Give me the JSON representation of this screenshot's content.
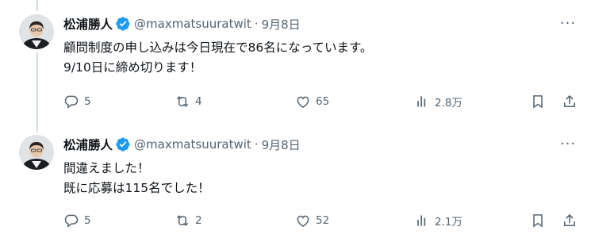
{
  "tweets": [
    {
      "author": {
        "name": "松浦勝人",
        "handle": "@maxmatsuuratwit",
        "separator": "·",
        "date": "9月8日"
      },
      "body_lines": [
        "顧問制度の申し込みは今日現在で86名になっています。",
        "9/10日に締め切ります！"
      ],
      "stats": {
        "replies": "5",
        "retweets": "4",
        "likes": "65",
        "views": "2.8万"
      }
    },
    {
      "author": {
        "name": "松浦勝人",
        "handle": "@maxmatsuuratwit",
        "separator": "·",
        "date": "9月8日"
      },
      "body_lines": [
        "間違えました！",
        "既に応募は115名でした！"
      ],
      "stats": {
        "replies": "5",
        "retweets": "2",
        "likes": "52",
        "views": "2.1万"
      }
    }
  ],
  "more_label": "···",
  "colors": {
    "text": "#0f1419",
    "muted": "#536471",
    "verified": "#1d9bf0",
    "thread": "#cfd9de"
  },
  "icons": [
    "reply-icon",
    "retweet-icon",
    "like-icon",
    "views-icon",
    "bookmark-icon",
    "share-icon",
    "verified-badge-icon",
    "more-icon"
  ]
}
